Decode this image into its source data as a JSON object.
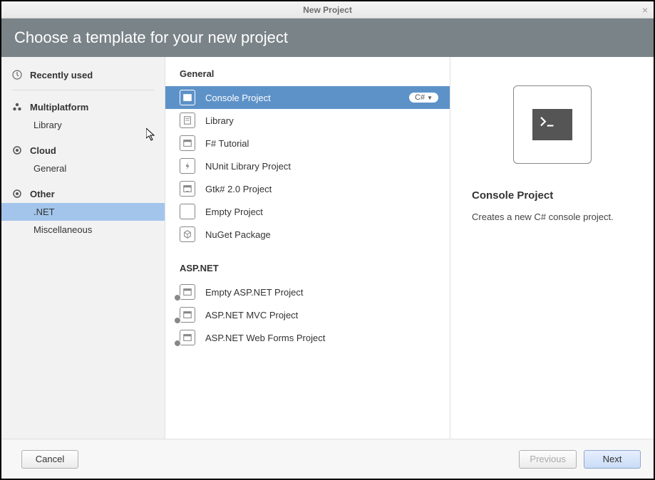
{
  "window": {
    "title": "New Project"
  },
  "header": {
    "title": "Choose a template for your new project"
  },
  "sidebar": {
    "recently_used": "Recently used",
    "sections": [
      {
        "label": "Multiplatform",
        "items": [
          "Library"
        ]
      },
      {
        "label": "Cloud",
        "items": [
          "General"
        ]
      },
      {
        "label": "Other",
        "items": [
          ".NET",
          "Miscellaneous"
        ],
        "selected": ".NET"
      }
    ]
  },
  "groups": [
    {
      "name": "General",
      "templates": [
        {
          "label": "Console Project",
          "selected": true,
          "lang": "C#",
          "icon": "console"
        },
        {
          "label": "Library",
          "icon": "library"
        },
        {
          "label": "F# Tutorial",
          "icon": "tutorial"
        },
        {
          "label": "NUnit Library Project",
          "icon": "bolt"
        },
        {
          "label": "Gtk# 2.0 Project",
          "icon": "grid"
        },
        {
          "label": "Empty Project",
          "icon": "empty"
        },
        {
          "label": "NuGet Package",
          "icon": "package"
        }
      ]
    },
    {
      "name": "ASP.NET",
      "templates": [
        {
          "label": "Empty ASP.NET Project",
          "icon": "web",
          "badge": true
        },
        {
          "label": "ASP.NET MVC Project",
          "icon": "web",
          "badge": true
        },
        {
          "label": "ASP.NET Web Forms Project",
          "icon": "web",
          "badge": true
        }
      ]
    }
  ],
  "detail": {
    "title": "Console Project",
    "description": "Creates a new C# console project."
  },
  "footer": {
    "cancel": "Cancel",
    "previous": "Previous",
    "next": "Next"
  }
}
